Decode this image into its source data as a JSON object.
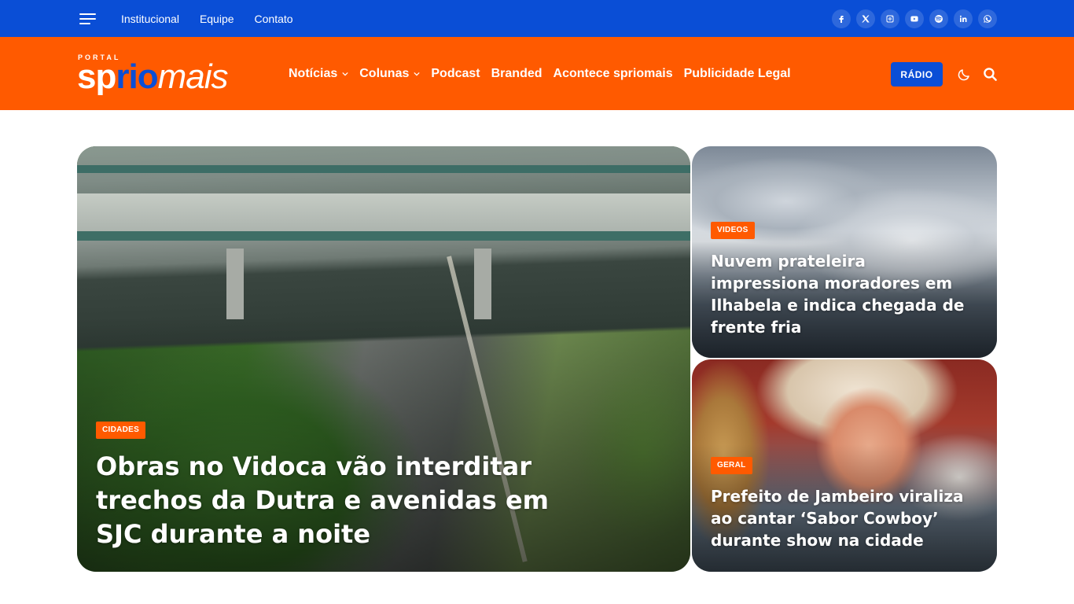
{
  "topbar": {
    "links": [
      "Institucional",
      "Equipe",
      "Contato"
    ],
    "socials": [
      "facebook-icon",
      "x-icon",
      "instagram-icon",
      "youtube-icon",
      "spotify-icon",
      "linkedin-icon",
      "whatsapp-icon"
    ]
  },
  "brand": {
    "portal_label": "PORTAL",
    "logo_sp": "sp",
    "logo_rio": "rio",
    "logo_mais": "mais",
    "accent_orange": "#ff5a00",
    "accent_blue": "#0a4ed6"
  },
  "nav": {
    "items": [
      "Notícias",
      "Colunas",
      "Podcast",
      "Branded",
      "Acontece spriomais",
      "Publicidade Legal"
    ],
    "radio_label": "RÁDIO"
  },
  "featured": {
    "main": {
      "category": "CIDADES",
      "title": "Obras no Vidoca vão interditar trechos da Dutra e avenidas em SJC durante a noite"
    },
    "side": [
      {
        "category": "VIDEOS",
        "title": "Nuvem prateleira impressiona moradores em Ilhabela e indica chegada de frente fria"
      },
      {
        "category": "GERAL",
        "title": "Prefeito de Jambeiro viraliza ao cantar ‘Sabor Cowboy’ durante show na cidade"
      }
    ]
  }
}
